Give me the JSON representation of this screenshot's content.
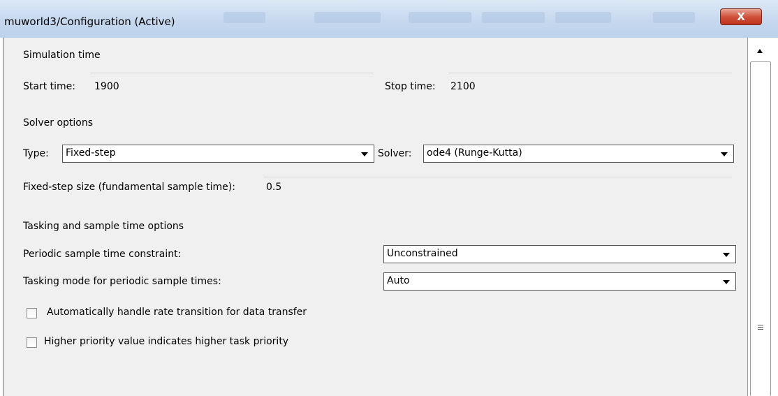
{
  "window": {
    "title": "muworld3/Configuration (Active)",
    "close_label": "X"
  },
  "simulation_time": {
    "heading": "Simulation time",
    "start_label": "Start time:",
    "start_value": "1900",
    "stop_label": "Stop time:",
    "stop_value": "2100"
  },
  "solver_options": {
    "heading": "Solver options",
    "type_label": "Type:",
    "type_value": "Fixed-step",
    "solver_label": "Solver:",
    "solver_value": "ode4 (Runge-Kutta)",
    "step_size_label": "Fixed-step size (fundamental sample time):",
    "step_size_value": "0.5"
  },
  "tasking": {
    "heading": "Tasking and sample time options",
    "periodic_label": "Periodic sample time constraint:",
    "periodic_value": "Unconstrained",
    "mode_label": "Tasking mode for periodic sample times:",
    "mode_value": "Auto",
    "checkbox_rate_transition": {
      "label": "Automatically handle rate transition for data transfer",
      "checked": false
    },
    "checkbox_priority": {
      "label": "Higher priority value indicates higher task priority",
      "checked": false
    }
  },
  "scrollbar": {
    "grip_icon": "grip-icon",
    "up_icon": "scroll-up-arrow-icon"
  }
}
